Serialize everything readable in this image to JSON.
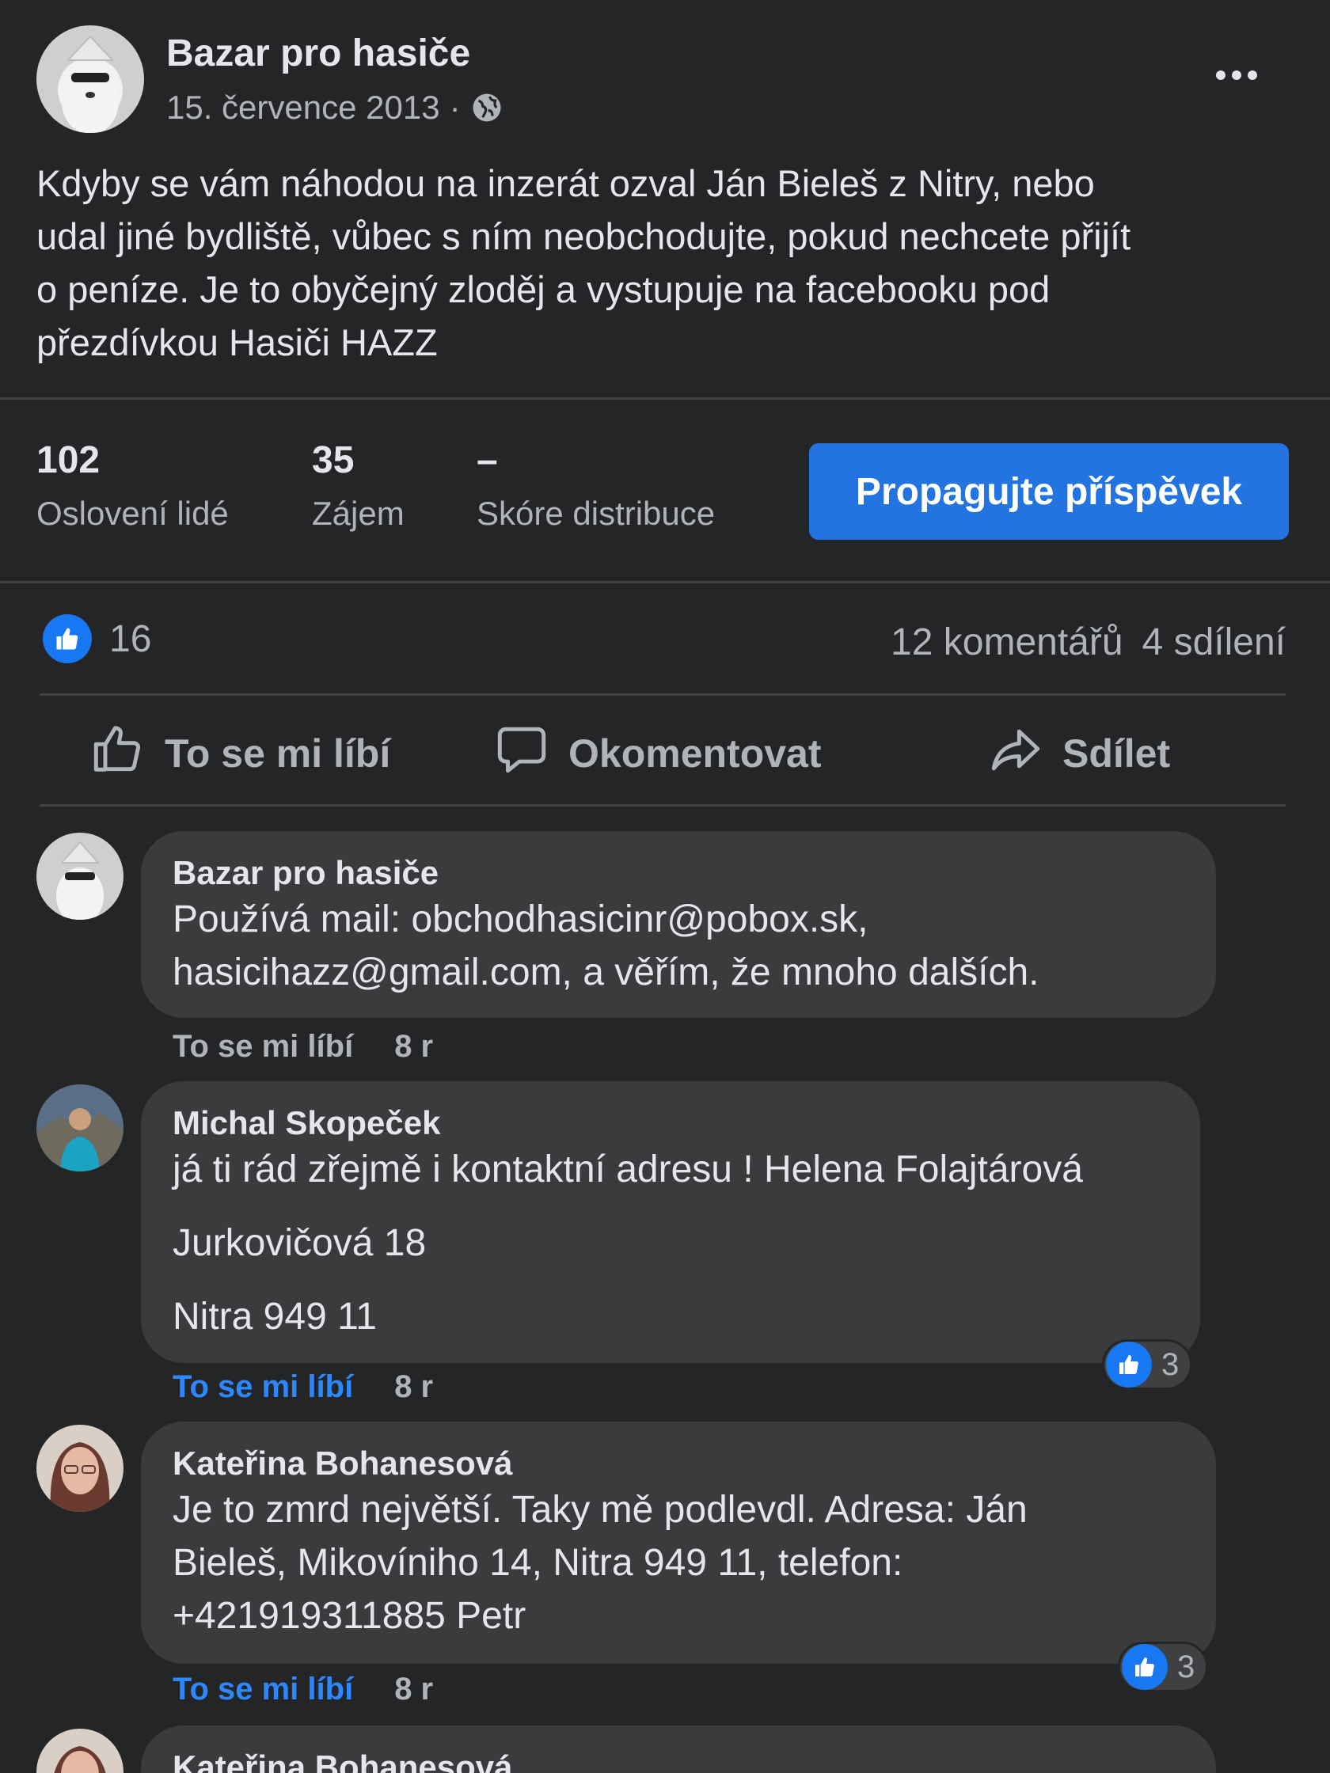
{
  "post": {
    "page_name": "Bazar pro hasiče",
    "date": "15. července 2013",
    "separator": "·",
    "audience_icon": "globe-icon",
    "more_icon": "more-horizontal-icon",
    "text_lines": [
      "Kdyby se vám náhodou na inzerát ozval Ján Bieleš z Nitry, nebo",
      "udal jiné bydliště, vůbec s ním neobchodujte, pokud nechcete přijít",
      "o peníze. Je to obyčejný zloděj a vystupuje na facebooku pod",
      "přezdívkou Hasiči HAZZ"
    ]
  },
  "insights": {
    "reach_value": "102",
    "reach_label": "Oslovení lidé",
    "engagement_value": "35",
    "engagement_label": "Zájem",
    "distribution_value": "–",
    "distribution_label": "Skóre distribuce",
    "boost_label": "Propagujte příspěvek"
  },
  "reactions": {
    "count": "16",
    "comments": "12 komentářů",
    "shares": "4 sdílení"
  },
  "actions": {
    "like_label": "To se mi líbí",
    "comment_label": "Okomentovat",
    "share_label": "Sdílet"
  },
  "comments": [
    {
      "author": "Bazar pro hasiče",
      "lines": [
        "Používá mail: obchodhasicinr@pobox.sk,",
        "hasicihazz@gmail.com, a věřím, že mnoho dalších."
      ],
      "like_label": "To se mi líbí",
      "time": "8 r"
    },
    {
      "author": "Michal Skopeček",
      "lines": [
        "já ti rád zřejmě i kontaktní adresu ! Helena Folajtárová",
        "Jurkovičová 18",
        "Nitra 949 11"
      ],
      "like_label": "To se mi líbí",
      "time": "8 r",
      "reaction_count": "3"
    },
    {
      "author": "Kateřina Bohanesová",
      "lines": [
        "Je to zmrd největší. Taky mě podlevdl. Adresa: Ján",
        "Bieleš, Mikovíniho 14, Nitra 949 11, telefon:",
        "+421919311885 Petr"
      ],
      "like_label": "To se mi líbí",
      "time": "8 r",
      "reaction_count": "3"
    },
    {
      "author": "Kateřina Bohanesová"
    }
  ],
  "colors": {
    "background": "#242526",
    "bubble": "#3a3b3c",
    "accent": "#2374e1",
    "liked_text": "#2d88ff"
  }
}
